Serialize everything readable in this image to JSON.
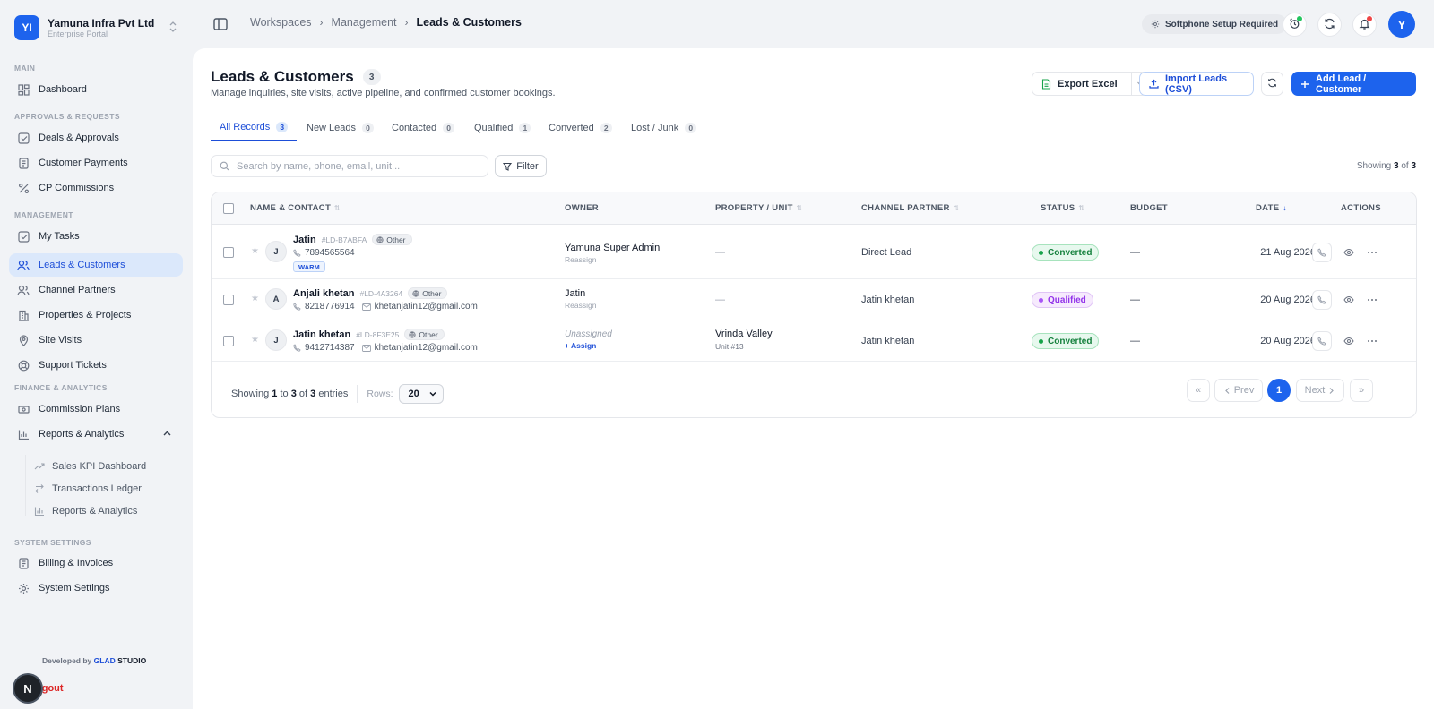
{
  "org": {
    "initials": "YI",
    "name": "Yamuna Infra Pvt Ltd",
    "subtitle": "Enterprise Portal"
  },
  "sidebar": {
    "sections": {
      "main": "MAIN",
      "approvals": "APPROVALS & REQUESTS",
      "management": "MANAGEMENT",
      "finance": "FINANCE & ANALYTICS",
      "system": "SYSTEM SETTINGS"
    },
    "items": {
      "dashboard": "Dashboard",
      "deals": "Deals & Approvals",
      "payments": "Customer Payments",
      "commissions": "CP Commissions",
      "tasks": "My Tasks",
      "leads": "Leads & Customers",
      "partners": "Channel Partners",
      "properties": "Properties & Projects",
      "visits": "Site Visits",
      "tickets": "Support Tickets",
      "plans": "Commission Plans",
      "reports": "Reports & Analytics",
      "billing": "Billing & Invoices",
      "settings": "System Settings"
    },
    "sub_items": {
      "kpi": "Sales KPI Dashboard",
      "ledger": "Transactions Ledger",
      "reports": "Reports & Analytics"
    },
    "footer": {
      "developed_by": "Developed by",
      "brand": "GLAD",
      "studio": "STUDIO",
      "logout": "ogout",
      "bubble": "N"
    }
  },
  "header": {
    "breadcrumbs": [
      "Workspaces",
      "Management",
      "Leads & Customers"
    ],
    "softphone": "Softphone Setup Required",
    "avatar": "Y"
  },
  "page": {
    "title": "Leads & Customers",
    "count": "3",
    "subtitle": "Manage inquiries, site visits, active pipeline, and confirmed customer bookings.",
    "buttons": {
      "export": "Export Excel",
      "import": "Import Leads (CSV)",
      "add": "Add Lead / Customer"
    }
  },
  "tabs": [
    {
      "label": "All Records",
      "count": "3"
    },
    {
      "label": "New Leads",
      "count": "0"
    },
    {
      "label": "Contacted",
      "count": "0"
    },
    {
      "label": "Qualified",
      "count": "1"
    },
    {
      "label": "Converted",
      "count": "2"
    },
    {
      "label": "Lost / Junk",
      "count": "0"
    }
  ],
  "toolbar": {
    "search_placeholder": "Search by name, phone, email, unit...",
    "filter": "Filter",
    "showing_prefix": "Showing",
    "showing_count": "3",
    "showing_of": "of",
    "showing_total": "3"
  },
  "table": {
    "columns": {
      "name": "NAME & CONTACT",
      "owner": "OWNER",
      "property": "PROPERTY / UNIT",
      "partner": "CHANNEL PARTNER",
      "status": "STATUS",
      "budget": "BUDGET",
      "date": "DATE",
      "actions": "ACTIONS"
    },
    "rows": [
      {
        "initial": "J",
        "name": "Jatin",
        "id": "#LD-B7ABFA",
        "source": "Other",
        "phone": "7894565564",
        "email": "",
        "tag": "WARM",
        "owner": "Yamuna Super Admin",
        "owner_action": "Reassign",
        "property": "—",
        "unit": "",
        "partner": "Direct Lead",
        "status": "Converted",
        "budget": "—",
        "date": "21 Aug 2026"
      },
      {
        "initial": "A",
        "name": "Anjali khetan",
        "id": "#LD-4A3264",
        "source": "Other",
        "phone": "8218776914",
        "email": "khetanjatin12@gmail.com",
        "tag": "",
        "owner": "Jatin",
        "owner_action": "Reassign",
        "property": "—",
        "unit": "",
        "partner": "Jatin khetan",
        "status": "Qualified",
        "budget": "—",
        "date": "20 Aug 2026"
      },
      {
        "initial": "J",
        "name": "Jatin khetan",
        "id": "#LD-8F3E25",
        "source": "Other",
        "phone": "9412714387",
        "email": "khetanjatin12@gmail.com",
        "tag": "",
        "owner": "Unassigned",
        "owner_action": "+ Assign",
        "property": "Vrinda Valley",
        "unit": "Unit #13",
        "partner": "Jatin khetan",
        "status": "Converted",
        "budget": "—",
        "date": "20 Aug 2026"
      }
    ]
  },
  "footer": {
    "showing": "Showing",
    "from": "1",
    "to_word": "to",
    "to": "3",
    "of_word": "of",
    "total": "3",
    "entries": "entries",
    "rows_label": "Rows:",
    "rows_value": "20",
    "prev": "Prev",
    "next": "Next",
    "page": "1",
    "first_glyph": "«",
    "last_glyph": "»"
  },
  "colors": {
    "primary": "#1d63ed",
    "converted_bg": "#e7f8ee",
    "converted_fg": "#15803d",
    "qualified_bg": "#f6eafd",
    "qualified_fg": "#9333ea"
  },
  "icons": {
    "nav": [
      "grid-icon",
      "check-square-icon",
      "payment-icon",
      "percent-icon",
      "check-square-icon",
      "users-icon",
      "users-icon",
      "building-icon",
      "map-pin-icon",
      "lifebuoy-icon",
      "money-icon",
      "bar-chart-icon",
      "invoice-icon",
      "gear-icon"
    ]
  }
}
